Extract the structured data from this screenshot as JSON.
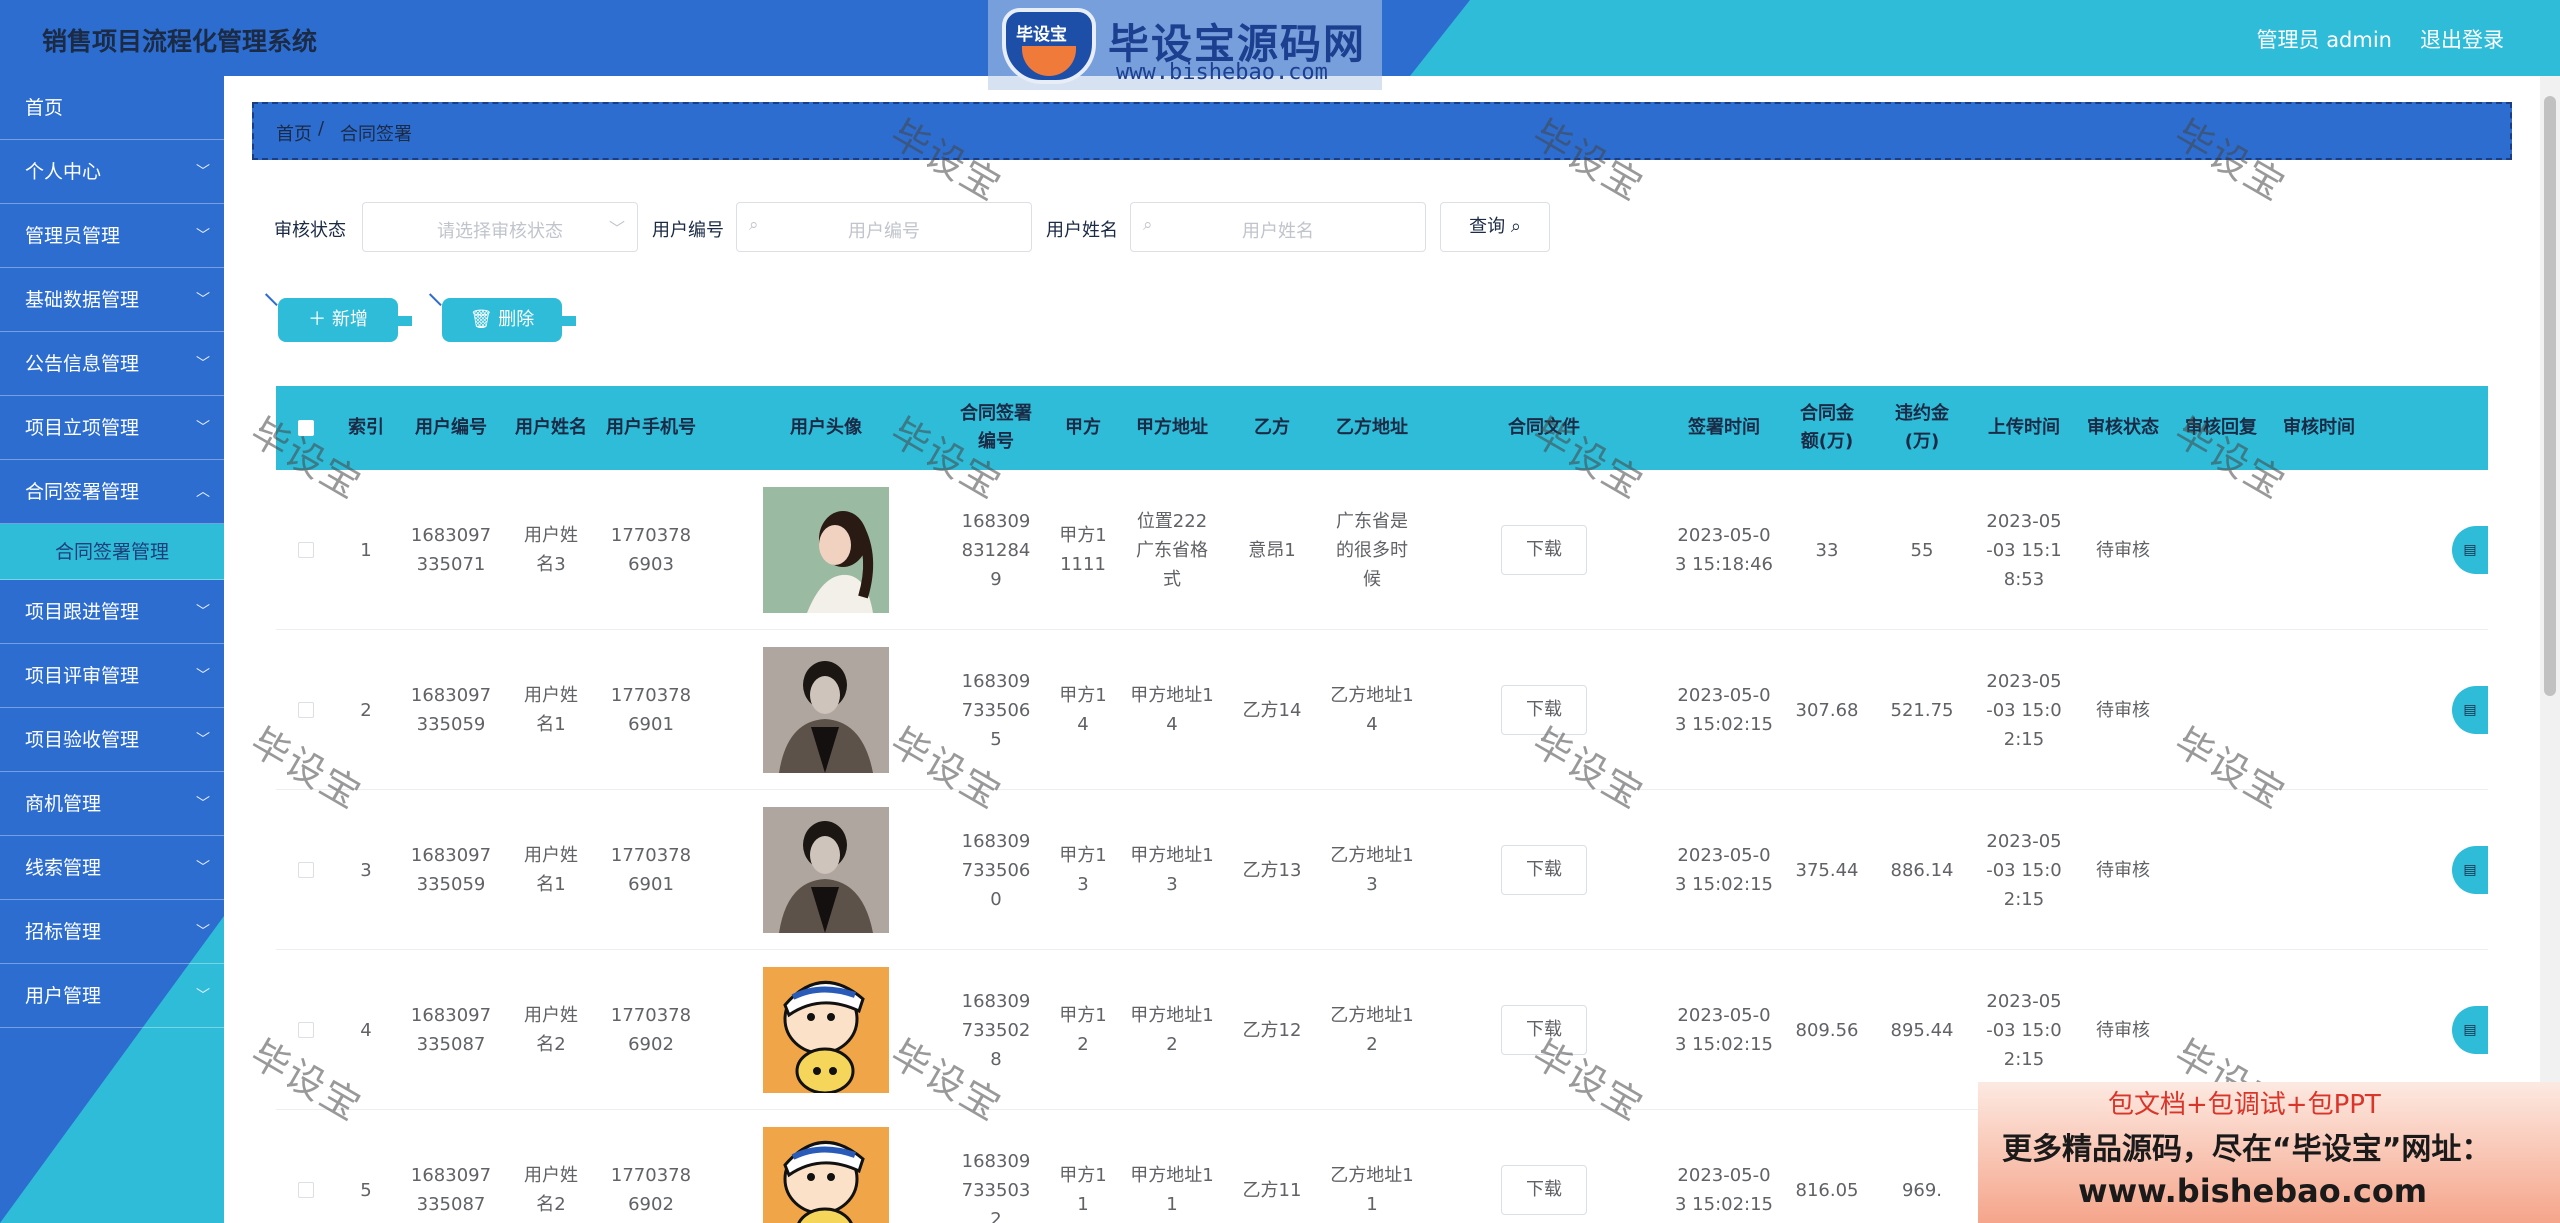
{
  "header": {
    "app_title": "销售项目流程化管理系统",
    "user_label": "管理员 admin",
    "logout": "退出登录",
    "watermark_logo": {
      "badge": "毕设宝",
      "name": "毕设宝源码网",
      "url": "www.bishebao.com"
    }
  },
  "sidebar": {
    "items": [
      {
        "label": "首页",
        "has_chevron": false
      },
      {
        "label": "个人中心",
        "has_chevron": true
      },
      {
        "label": "管理员管理",
        "has_chevron": true
      },
      {
        "label": "基础数据管理",
        "has_chevron": true
      },
      {
        "label": "公告信息管理",
        "has_chevron": true
      },
      {
        "label": "项目立项管理",
        "has_chevron": true
      },
      {
        "label": "合同签署管理",
        "has_chevron": true
      },
      {
        "label": "合同签署管理",
        "is_sub": true
      },
      {
        "label": "项目跟进管理",
        "has_chevron": true
      },
      {
        "label": "项目评审管理",
        "has_chevron": true
      },
      {
        "label": "项目验收管理",
        "has_chevron": true
      },
      {
        "label": "商机管理",
        "has_chevron": true
      },
      {
        "label": "线索管理",
        "has_chevron": true
      },
      {
        "label": "招标管理",
        "has_chevron": true
      },
      {
        "label": "用户管理",
        "has_chevron": true
      }
    ]
  },
  "breadcrumb": {
    "home": "首页",
    "separator": "/",
    "current": "合同签署"
  },
  "filters": {
    "status_label": "审核状态",
    "status_placeholder": "请选择审核状态",
    "user_id_label": "用户编号",
    "user_id_placeholder": "用户编号",
    "user_name_label": "用户姓名",
    "user_name_placeholder": "用户姓名",
    "query_button": "查询 ⌕"
  },
  "actions": {
    "add": "＋ 新增",
    "delete": "🗑 删除"
  },
  "table": {
    "columns": [
      "索引",
      "用户编号",
      "用户姓名",
      "用户手机号",
      "用户头像",
      "合同签署编号",
      "甲方",
      "甲方地址",
      "乙方",
      "乙方地址",
      "合同文件",
      "签署时间",
      "合同金额(万)",
      "违约金(万)",
      "上传时间",
      "审核状态",
      "审核回复",
      "审核时间"
    ],
    "download_label": "下载",
    "rows": [
      {
        "index": "1",
        "user_id": "1683097335071",
        "user_name": "用户姓名3",
        "phone": "17703786903",
        "avatar": "photo-girl",
        "contract_no": "1683098312849",
        "party_a": "甲方11111",
        "party_a_addr": "位置222广东省格式",
        "party_b": "意昂1",
        "party_b_addr": "广东省是的很多时候",
        "sign_time": "2023-05-03 15:18:46",
        "amount": "33",
        "penalty": "55",
        "upload_time": "2023-05-03 15:18:53",
        "status": "待审核",
        "reply": "",
        "review_time": ""
      },
      {
        "index": "2",
        "user_id": "1683097335059",
        "user_name": "用户姓名1",
        "phone": "17703786901",
        "avatar": "photo-man",
        "contract_no": "1683097335065",
        "party_a": "甲方14",
        "party_a_addr": "甲方地址14",
        "party_b": "乙方14",
        "party_b_addr": "乙方地址14",
        "sign_time": "2023-05-03 15:02:15",
        "amount": "307.68",
        "penalty": "521.75",
        "upload_time": "2023-05-03 15:02:15",
        "status": "待审核",
        "reply": "",
        "review_time": ""
      },
      {
        "index": "3",
        "user_id": "1683097335059",
        "user_name": "用户姓名1",
        "phone": "17703786901",
        "avatar": "photo-man",
        "contract_no": "1683097335060",
        "party_a": "甲方13",
        "party_a_addr": "甲方地址13",
        "party_b": "乙方13",
        "party_b_addr": "乙方地址13",
        "sign_time": "2023-05-03 15:02:15",
        "amount": "375.44",
        "penalty": "886.14",
        "upload_time": "2023-05-03 15:02:15",
        "status": "待审核",
        "reply": "",
        "review_time": ""
      },
      {
        "index": "4",
        "user_id": "1683097335087",
        "user_name": "用户姓名2",
        "phone": "17703786902",
        "avatar": "cartoon-boy",
        "contract_no": "1683097335028",
        "party_a": "甲方12",
        "party_a_addr": "甲方地址12",
        "party_b": "乙方12",
        "party_b_addr": "乙方地址12",
        "sign_time": "2023-05-03 15:02:15",
        "amount": "809.56",
        "penalty": "895.44",
        "upload_time": "2023-05-03 15:02:15",
        "status": "待审核",
        "reply": "",
        "review_time": ""
      },
      {
        "index": "5",
        "user_id": "1683097335087",
        "user_name": "用户姓名2",
        "phone": "17703786902",
        "avatar": "cartoon-boy",
        "contract_no": "1683097335032",
        "party_a": "甲方11",
        "party_a_addr": "甲方地址11",
        "party_b": "乙方11",
        "party_b_addr": "乙方地址11",
        "sign_time": "2023-05-03 15:02:15",
        "amount": "816.05",
        "penalty": "969.",
        "upload_time": "",
        "status": "",
        "reply": "",
        "review_time": ""
      }
    ]
  },
  "watermark_text": "毕设宝",
  "promo": {
    "line1": "包文档+包调试+包PPT",
    "line2": "更多精品源码，尽在“毕设宝”网址：",
    "line3": "www.bishebao.com"
  },
  "colors": {
    "primary_blue": "#2d6dd0",
    "accent_cyan": "#2fbcd9"
  }
}
